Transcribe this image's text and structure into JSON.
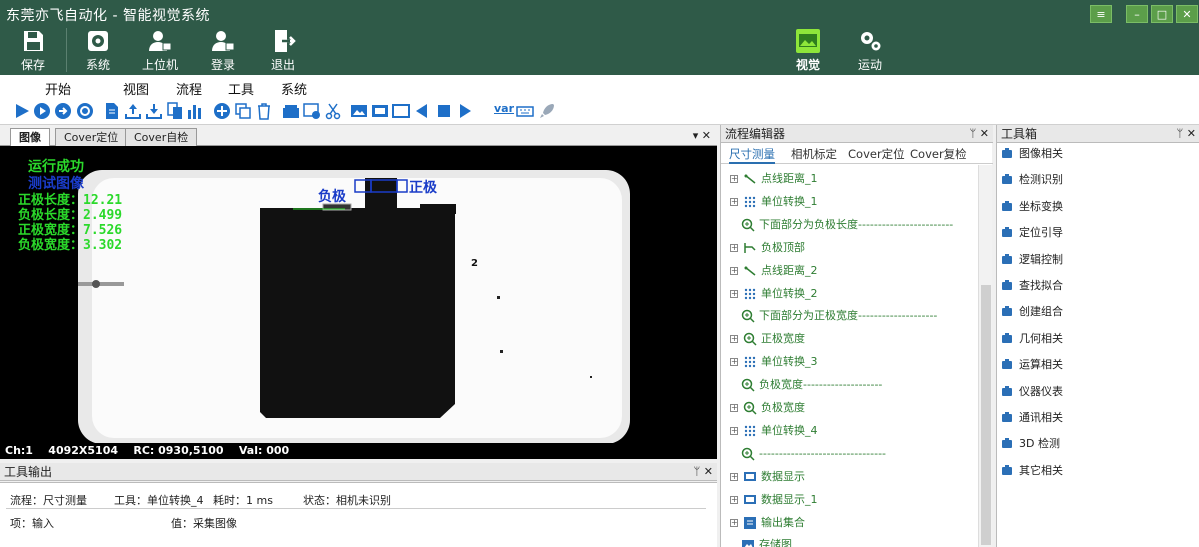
{
  "window": {
    "title": "东莞亦飞自动化 - 智能视觉系统",
    "controls": {
      "menu": "≡",
      "minimize": "–",
      "maximize": "□",
      "close": "✕"
    }
  },
  "ribbon": {
    "buttons": [
      {
        "label": "保存",
        "icon": "floppy-icon"
      },
      {
        "label": "系统",
        "icon": "gear-icon"
      },
      {
        "label": "上位机",
        "icon": "user-lock-icon"
      },
      {
        "label": "登录",
        "icon": "user-login-icon"
      },
      {
        "label": "退出",
        "icon": "exit-icon"
      },
      {
        "label": "视觉",
        "icon": "image-icon"
      },
      {
        "label": "运动",
        "icon": "gears-icon"
      }
    ]
  },
  "menu": [
    "开始",
    "视图",
    "流程",
    "工具",
    "系统"
  ],
  "toolbar": {
    "var_label": "var"
  },
  "image_panel": {
    "tabs": [
      "图像",
      "Cover定位",
      "Cover自检"
    ],
    "active_tab": "图像",
    "overlay": {
      "run_status": "运行成功",
      "test_image": "测试图像",
      "measurements": [
        "正极长度：12.21",
        "负极长度：2.499",
        "正极宽度：7.526",
        "负极宽度：3.302"
      ],
      "neg_label": "负极",
      "pos_label": "正极",
      "marker": "2"
    },
    "status": {
      "channel": "Ch:1",
      "size": "4092X5104",
      "rc": "RC: 0930,5100",
      "val": "Val: 000"
    }
  },
  "tool_output": {
    "title": "工具输出",
    "pin": "ᛘ ✕",
    "line1": {
      "flow": "流程：尺寸测量",
      "tool": "工具：单位转换_4",
      "time": "耗时：1 ms",
      "state": "状态：相机未识别"
    },
    "line2": {
      "item": "项：输入",
      "value": "值：采集图像"
    }
  },
  "flow_editor": {
    "title": "流程编辑器",
    "pin": "ᛘ ✕",
    "tabs": [
      "尺寸测量",
      "相机标定",
      "Cover定位",
      "Cover复检"
    ],
    "active_tab": "尺寸测量",
    "items": [
      {
        "label": "点线距离_1",
        "icon": "line-measure-icon",
        "expand": true
      },
      {
        "label": "单位转换_1",
        "icon": "grid-dots-icon",
        "expand": true
      },
      {
        "label": "下面部分为负极长度------------------------",
        "icon": "zoom-icon",
        "expand": false
      },
      {
        "label": "负极顶部",
        "icon": "branch-icon",
        "expand": true
      },
      {
        "label": "点线距离_2",
        "icon": "line-measure-icon",
        "expand": true
      },
      {
        "label": "单位转换_2",
        "icon": "grid-dots-icon",
        "expand": true
      },
      {
        "label": "下面部分为正极宽度--------------------",
        "icon": "zoom-icon",
        "expand": false
      },
      {
        "label": "正极宽度",
        "icon": "zoom-icon",
        "expand": true
      },
      {
        "label": "单位转换_3",
        "icon": "grid-dots-icon",
        "expand": true
      },
      {
        "label": "负极宽度--------------------",
        "icon": "zoom-icon",
        "expand": false
      },
      {
        "label": "负极宽度",
        "icon": "zoom-icon",
        "expand": true
      },
      {
        "label": "单位转换_4",
        "icon": "grid-dots-icon",
        "expand": true
      },
      {
        "label": "--------------------------------",
        "icon": "zoom-icon",
        "expand": false
      },
      {
        "label": "数据显示",
        "icon": "display-icon",
        "expand": true
      },
      {
        "label": "数据显示_1",
        "icon": "display-icon",
        "expand": true
      },
      {
        "label": "输出集合",
        "icon": "collection-icon",
        "expand": true
      },
      {
        "label": "存储图",
        "icon": "save-image-icon",
        "expand": false
      }
    ]
  },
  "toolbox": {
    "title": "工具箱",
    "pin": "ᛘ ✕",
    "items": [
      "图像相关",
      "检测识别",
      "坐标变换",
      "定位引导",
      "逻辑控制",
      "查找拟合",
      "创建组合",
      "几何相关",
      "运算相关",
      "仪器仪表",
      "通讯相关",
      "3D  检测",
      "其它相关"
    ]
  },
  "colors": {
    "ribbon": "#2f5a48",
    "overlay_green": "#2bd92b",
    "overlay_blue": "#1a3cc8",
    "flow_text": "#2e7d32",
    "link_blue": "#2a6fb0"
  }
}
